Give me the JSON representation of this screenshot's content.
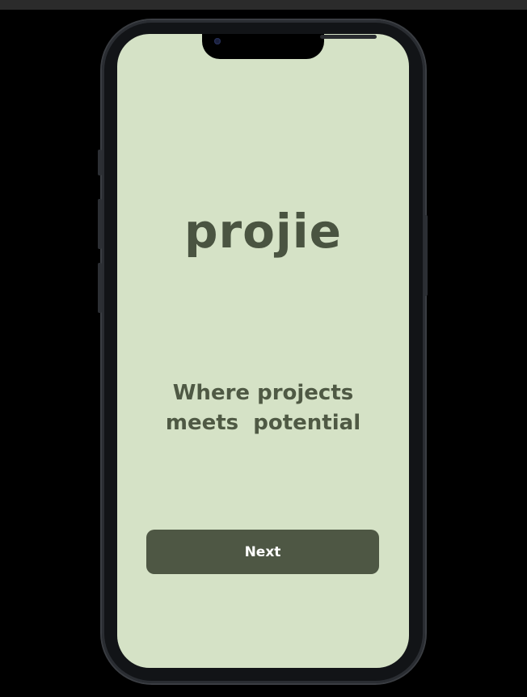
{
  "app": {
    "logo_text": "projie",
    "tagline_line1": "Where projects",
    "tagline_line2": "meets  potential",
    "next_label": "Next"
  },
  "colors": {
    "screen_background": "#d5e2c6",
    "text_dark_green": "#4a5441",
    "button_background": "#4e5744",
    "button_text": "#ffffff",
    "device_frame": "#121417"
  }
}
